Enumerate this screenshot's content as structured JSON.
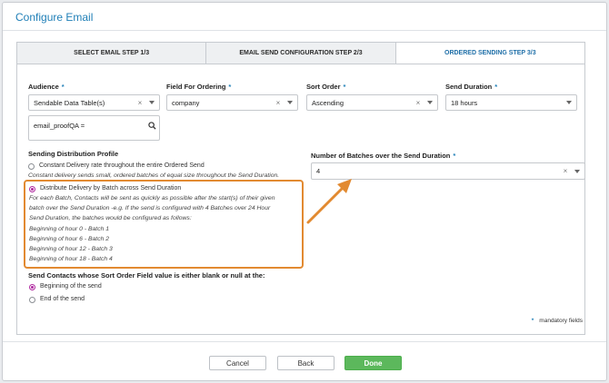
{
  "dialog": {
    "title": "Configure Email"
  },
  "tabs": [
    {
      "label": "SELECT EMAIL STEP 1/3"
    },
    {
      "label": "EMAIL SEND CONFIGURATION STEP 2/3"
    },
    {
      "label": "ORDERED SENDING STEP 3/3"
    }
  ],
  "fields": {
    "audience": {
      "label": "Audience",
      "value": "Sendable Data Table(s)"
    },
    "ordering": {
      "label": "Field For Ordering",
      "value": "company"
    },
    "sort_order": {
      "label": "Sort Order",
      "value": "Ascending"
    },
    "send_duration": {
      "label": "Send Duration",
      "value": "18 hours"
    },
    "email_filter": {
      "value": "email_proofQA ="
    },
    "batches": {
      "label": "Number of Batches over the Send Duration",
      "value": "4"
    }
  },
  "distribution": {
    "heading": "Sending Distribution Profile",
    "option1_label": "Constant Delivery rate throughout the entire Ordered Send",
    "option1_desc": "Constant delivery sends small, ordered batches of equal size throughout the Send Duration.",
    "option2_label": "Distribute Delivery by Batch across Send Duration",
    "option2_desc_lines": [
      "For each Batch, Contacts will be sent as quickly as possible after the start(s) of their given",
      "batch over the Send Duration -e.g. If the send is configured with 4 Batches over 24 Hour",
      "Send Duration, the batches would be configured as follows:",
      "Beginning of hour 0 - Batch 1",
      "Beginning of hour 6 - Batch 2",
      "Beginning of hour 12 - Batch 3",
      "Beginning of hour 18 - Batch 4"
    ]
  },
  "blank_handling": {
    "heading": "Send Contacts whose Sort Order Field value is either blank or null at the:",
    "option1": "Beginning of the send",
    "option2": "End of the send"
  },
  "mandatory_note": "mandatory fields",
  "required_marker": "*",
  "buttons": {
    "cancel": "Cancel",
    "back": "Back",
    "done": "Done"
  },
  "colors": {
    "accent": "#1f7fb7",
    "highlight": "#e28a31",
    "radio": "#b02aa0",
    "done": "#5cb85c"
  }
}
